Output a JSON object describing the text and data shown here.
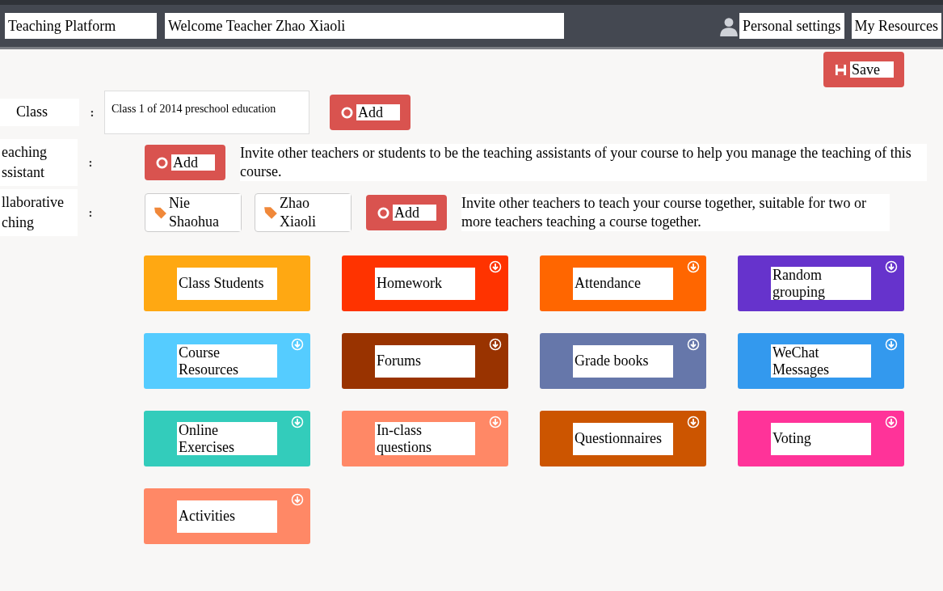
{
  "header": {
    "brand": "Teaching Platform",
    "welcome": "Welcome Teacher Zhao Xiaoli",
    "links": [
      "Personal settings",
      "My Resources"
    ]
  },
  "save_button": "Save",
  "form": {
    "class": {
      "label": "Class",
      "colon": ":",
      "value": "Class 1 of 2014 preschool education",
      "add": "Add"
    },
    "assistant": {
      "label": "eaching ssistant",
      "colon": ":",
      "add": "Add",
      "hint": "Invite other teachers or students to be the teaching assistants of your course to help you manage the teaching of this course."
    },
    "collaborative": {
      "label": "llaborative ching",
      "colon": ":",
      "teachers": [
        "Nie Shaohua",
        "Zhao Xiaoli"
      ],
      "add": "Add",
      "hint": "Invite other teachers to teach your course together, suitable for two or more teachers teaching a course together."
    }
  },
  "tiles": [
    {
      "label": "Class Students",
      "color": "#ffa812",
      "download": false
    },
    {
      "label": "Homework",
      "color": "#ff3300",
      "download": true
    },
    {
      "label": "Attendance",
      "color": "#ff6600",
      "download": true
    },
    {
      "label": "Random grouping",
      "color": "#6633cc",
      "download": true
    },
    {
      "label": "Course Resources",
      "color": "#55ccff",
      "download": true
    },
    {
      "label": "Forums",
      "color": "#993300",
      "download": true
    },
    {
      "label": "Grade books",
      "color": "#6677aa",
      "download": true
    },
    {
      "label": "WeChat Messages",
      "color": "#3399ee",
      "download": true
    },
    {
      "label": "Online Exercises",
      "color": "#33ccbb",
      "download": true
    },
    {
      "label": "In-class questions",
      "color": "#ff8866",
      "download": true
    },
    {
      "label": "Questionnaires",
      "color": "#cc5500",
      "download": true
    },
    {
      "label": "Voting",
      "color": "#ff3399",
      "download": true
    },
    {
      "label": "Activities",
      "color": "#ff8866",
      "download": true
    }
  ]
}
